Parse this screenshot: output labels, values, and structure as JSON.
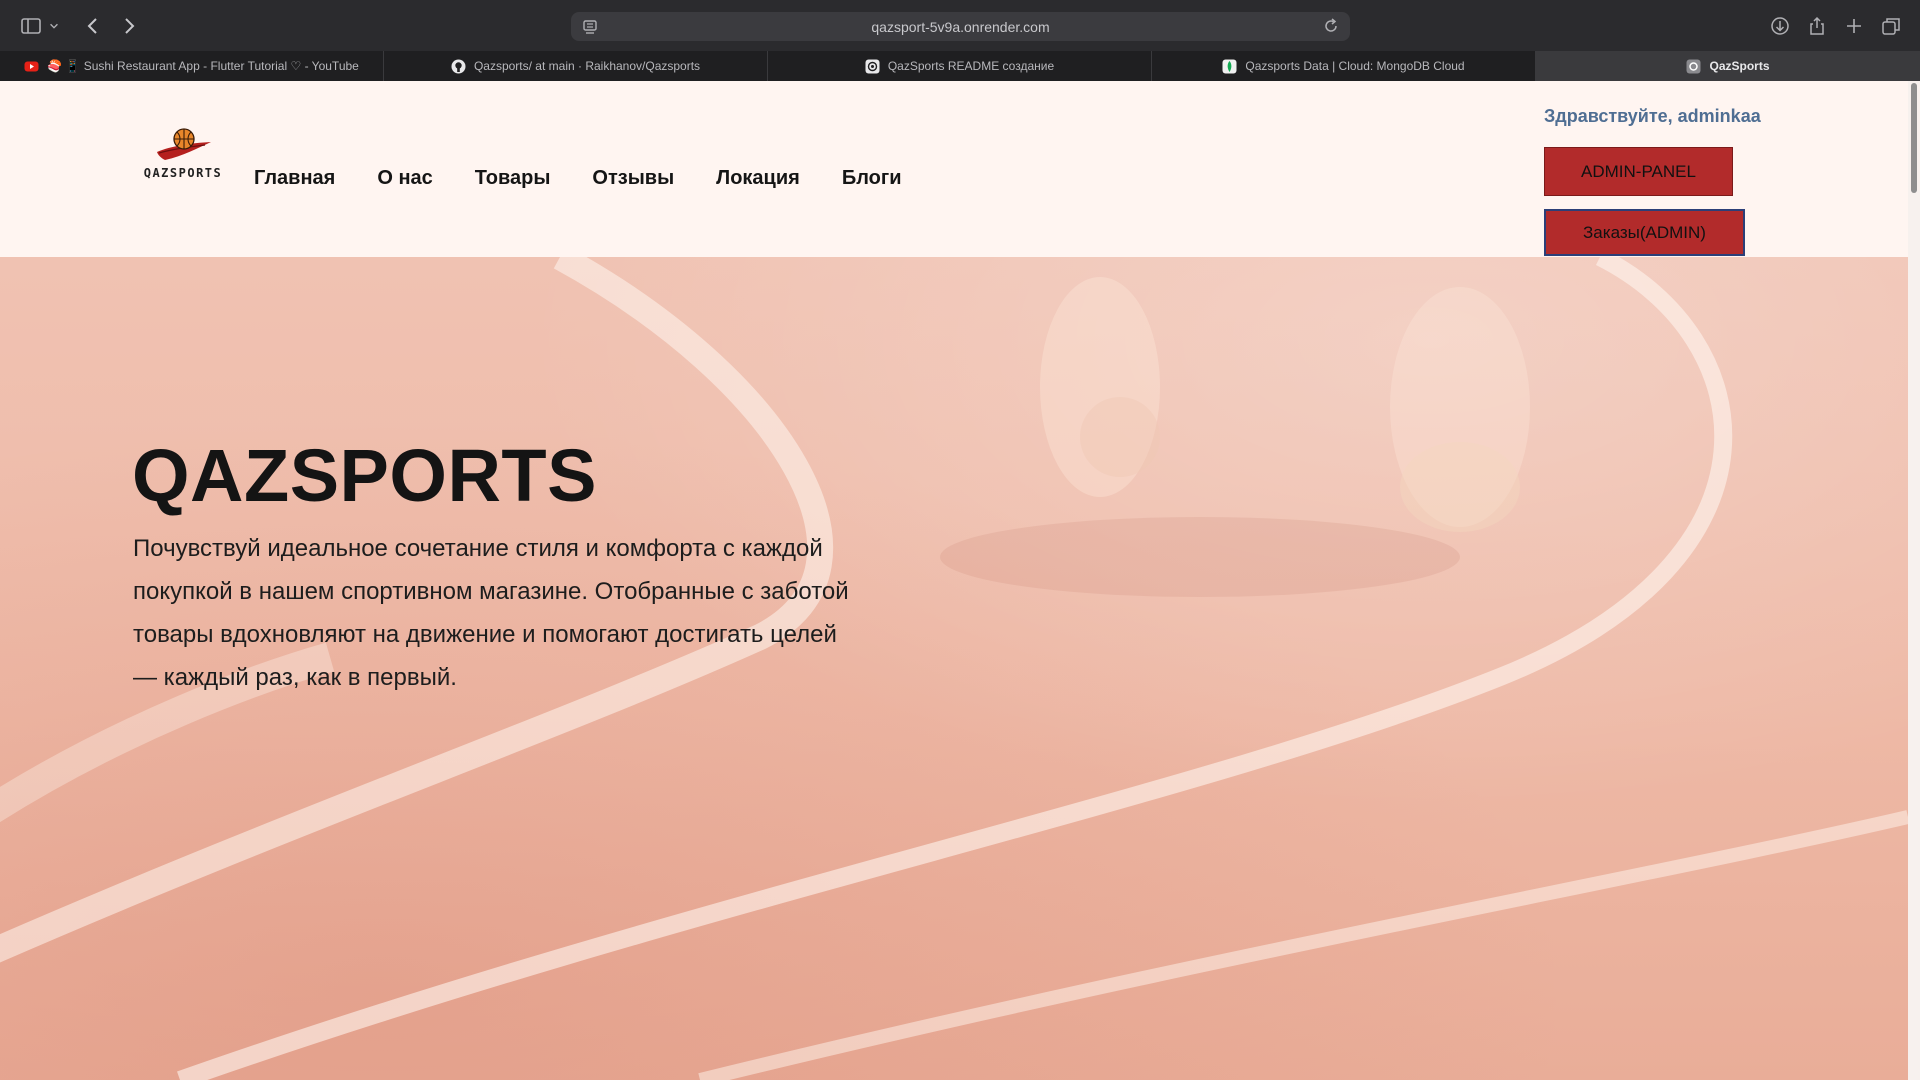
{
  "browser": {
    "url": "qazsport-5v9a.onrender.com",
    "tabs": [
      {
        "label": "🍣 📱 Sushi Restaurant App - Flutter Tutorial ♡ - YouTube",
        "icon": "youtube-icon",
        "active": false
      },
      {
        "label": "Qazsports/ at main · Raikhanov/Qazsports",
        "icon": "github-icon",
        "active": false
      },
      {
        "label": "QazSports README создание",
        "icon": "chatgpt-icon",
        "active": false
      },
      {
        "label": "Qazsports Data | Cloud: MongoDB Cloud",
        "icon": "mongodb-leaf-icon",
        "active": false
      },
      {
        "label": "QazSports",
        "icon": "site-q-icon",
        "active": true
      }
    ]
  },
  "site": {
    "logo_text": "QAZSPORTS",
    "nav": [
      "Главная",
      "О нас",
      "Товары",
      "Отзывы",
      "Локация",
      "Блоги"
    ],
    "greeting": "Здравствуйте, adminkaa",
    "admin_button": "ADMIN-PANEL",
    "orders_button": "Заказы(ADMIN)"
  },
  "hero": {
    "title": "QAZSPORTS",
    "text": "Почувствуй идеальное сочетание стиля и комфорта с каждой покупкой в нашем спортивном магазине. Отобранные с заботой товары вдохновляют на движение и помогают достигать целей — каждый раз, как в первый."
  },
  "colors": {
    "header_bg": "#fff5f1",
    "button_red": "#b22b2b",
    "greeting_blue": "#4f6e93",
    "hero_bg": "#f0c2b2"
  }
}
